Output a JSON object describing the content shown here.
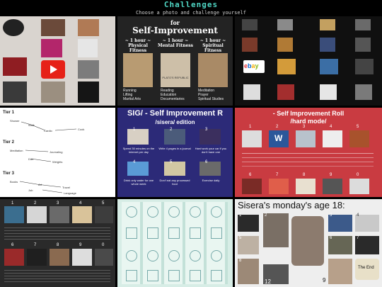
{
  "header": {
    "title": "Challenges",
    "subtitle": "Choose a photo and challenge yourself"
  },
  "tiles": {
    "self_improvement": {
      "for": "for",
      "title": "Self-Improvement",
      "columns": [
        {
          "head": "~ 1 hour ~",
          "sub": "Physical Fitness",
          "items": [
            "Running",
            "Lifting",
            "Martial Arts"
          ]
        },
        {
          "head": "~ 1 hour ~",
          "sub": "Mental Fitness",
          "items": [
            "Reading",
            "Education",
            "Documentaries"
          ]
        },
        {
          "head": "~ 1 hour ~",
          "sub": "Spiritual Fitness",
          "items": [
            "Meditation",
            "Prayer",
            "Spiritual Studies"
          ]
        }
      ],
      "book_label": "PLATO'S REPUBLIC"
    },
    "tiers": {
      "rows": [
        {
          "label": "Tier 1",
          "items": [
            "Shower",
            "Walk",
            "Cardio",
            "Language",
            "Cook"
          ]
        },
        {
          "label": "Tier 2",
          "items": [
            "Meditation",
            "Journaling",
            "Diet",
            "Weights"
          ]
        },
        {
          "label": "Tier 3",
          "items": [
            "Books",
            "Art",
            "Job",
            "Travel",
            "Language"
          ]
        }
      ]
    },
    "sig": {
      "title": "SIG/ - Self Improvement R",
      "subtitle": "/sisera/ edition",
      "cells": [
        "1",
        "2",
        "3",
        "4",
        "5",
        "6"
      ],
      "captions": [
        "Spend 30 minutes on the internet per day",
        "Write 4 pages in a journal",
        "Hard work your car if you don't have one",
        "Drink only water for one whole week",
        "Don't eat any processed food",
        "Exercise daily"
      ]
    },
    "roll": {
      "title": "- Self Improvement Roll",
      "subtitle": "/hard mode/",
      "cells": [
        "1",
        "2",
        "3",
        "4",
        "5",
        "6",
        "7",
        "8",
        "9",
        "0"
      ]
    },
    "icons": {
      "cells": [
        "1",
        "2",
        "3",
        "4",
        "5",
        "6",
        "7",
        "8",
        "9",
        "0"
      ]
    },
    "sisera": {
      "title": "Sisera's monday's age 18:",
      "numbers": [
        "1",
        "2",
        "3",
        "4",
        "5",
        "6",
        "7",
        "8",
        "9",
        "12"
      ],
      "bubble": "The End"
    }
  },
  "colors": {
    "accent": "#4fd6c4",
    "background": "#000000",
    "roll_red": "#c93b41",
    "sig_purple": "#2c2a78"
  }
}
